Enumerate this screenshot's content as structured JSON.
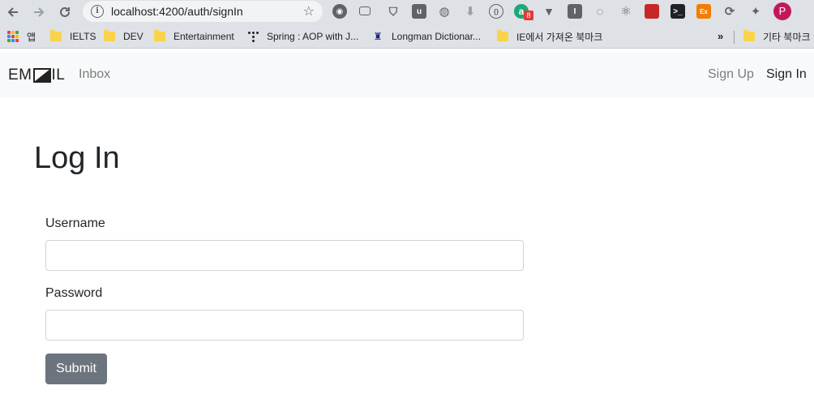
{
  "browser": {
    "url": "localhost:4200/auth/signIn",
    "extension_badge": "8",
    "profile_initial": "P",
    "bookmarks": [
      {
        "label": "앱"
      },
      {
        "label": "IELTS"
      },
      {
        "label": "DEV"
      },
      {
        "label": "Entertainment"
      },
      {
        "label": "Spring : AOP with J..."
      },
      {
        "label": "Longman Dictionar..."
      },
      {
        "label": "IE에서 가져온 북마크"
      },
      {
        "label": "기타 북마크"
      }
    ],
    "bookmarks_overflow": "»"
  },
  "navbar": {
    "brand_prefix": "EM",
    "brand_suffix": "IL",
    "inbox": "Inbox",
    "sign_up": "Sign Up",
    "sign_in": "Sign In"
  },
  "form": {
    "title": "Log In",
    "username_label": "Username",
    "username_value": "",
    "password_label": "Password",
    "password_value": "",
    "submit_label": "Submit"
  },
  "colors": {
    "navbar_bg": "#f8f9fa",
    "button_secondary": "#6c757d",
    "input_border": "#ced4da"
  }
}
